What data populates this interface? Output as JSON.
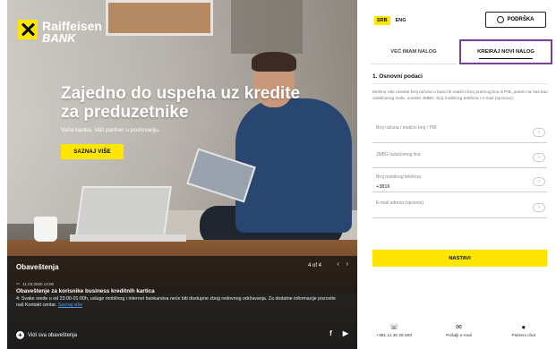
{
  "brand": {
    "line1": "Raiffeisen",
    "line2": "BANK"
  },
  "hero": {
    "headline": "Zajedno do uspeha uz kredite za preduzetnike",
    "subline": "Vaša banka, Vaš partner u poslovanju.",
    "cta_label": "SAZNAJ VIŠE"
  },
  "news": {
    "title": "Obaveštenja",
    "pager": "4 of 4",
    "prev": "‹",
    "next": "›",
    "date": "11.03.2020 13:00",
    "headline": "Obaveštenje za korisnike business kreditnih kartica",
    "body": "4: Svake srede u od 23:00-01:00h, usluge mobilnog i internet bankarstva neće biti dostupne zbog redovnog održavanja. Za dodatne informacije pozovite naš Kontakt centar.",
    "body_link": "Saznaj više",
    "all_label": "Vidi sva obaveštenja",
    "social_f": "f",
    "social_yt": "▶"
  },
  "language": {
    "active": "SRB",
    "other": "ENG"
  },
  "support_label": "PODRŠKA",
  "tabs": {
    "existing": "VEĆ IMAM NALOG",
    "new": "KREIRAJ NOVI NALOG"
  },
  "form": {
    "section_title": "1. Osnovni podaci",
    "intro": "Molimo Vas unesite broj računa u banci ili matični broj pravnog lica ili PIB, potom na Vas kao ovlašćenog ovde, unesite JMBG, broj mobilnog telefona i e-mail (opciono).",
    "fields": [
      {
        "label": "Broj računa / matični broj / PIB",
        "value": ""
      },
      {
        "label": "JMBG ovlašćenog lica",
        "value": ""
      },
      {
        "label": "Broj mobilnog telefona",
        "value": "+3816"
      },
      {
        "label": "E-mail adresa (opciono)",
        "value": ""
      }
    ],
    "info_glyph": "i",
    "submit_label": "NASTAVI"
  },
  "footer": [
    {
      "icon": "☏",
      "label": "+381 11 30 26 800"
    },
    {
      "icon": "✉",
      "label": "Pošalji e-mail"
    },
    {
      "icon": "●",
      "label": "Pokreni chat"
    }
  ],
  "colors": {
    "accent_yellow": "#ffe600",
    "highlight_purple": "#7b3f98"
  }
}
